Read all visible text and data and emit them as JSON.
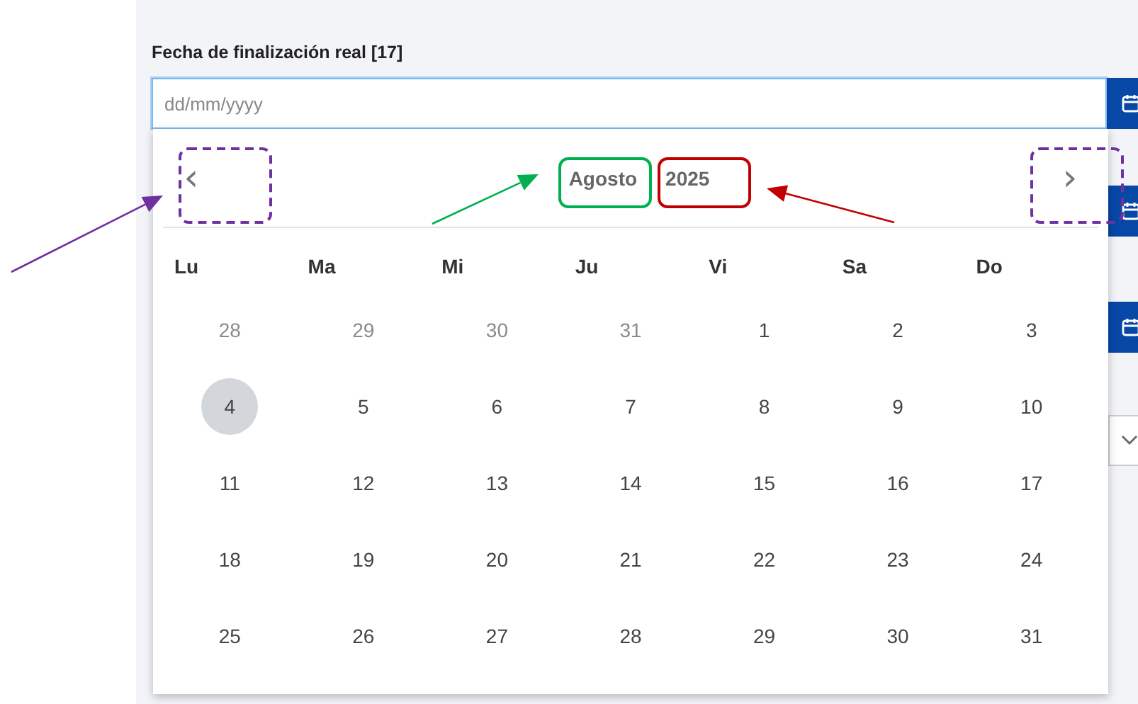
{
  "field": {
    "label": "Fecha de finalización real [17]",
    "placeholder": "dd/mm/yyyy"
  },
  "calendar": {
    "prev": "‹",
    "next": "›",
    "month": "Agosto",
    "year": "2025",
    "weekdays": [
      "Lu",
      "Ma",
      "Mi",
      "Ju",
      "Vi",
      "Sa",
      "Do"
    ],
    "weeks": [
      [
        {
          "day": "28",
          "outside": true,
          "selected": false
        },
        {
          "day": "29",
          "outside": true,
          "selected": false
        },
        {
          "day": "30",
          "outside": true,
          "selected": false
        },
        {
          "day": "31",
          "outside": true,
          "selected": false
        },
        {
          "day": "1",
          "outside": false,
          "selected": false
        },
        {
          "day": "2",
          "outside": false,
          "selected": false
        },
        {
          "day": "3",
          "outside": false,
          "selected": false
        }
      ],
      [
        {
          "day": "4",
          "outside": false,
          "selected": true
        },
        {
          "day": "5",
          "outside": false,
          "selected": false
        },
        {
          "day": "6",
          "outside": false,
          "selected": false
        },
        {
          "day": "7",
          "outside": false,
          "selected": false
        },
        {
          "day": "8",
          "outside": false,
          "selected": false
        },
        {
          "day": "9",
          "outside": false,
          "selected": false
        },
        {
          "day": "10",
          "outside": false,
          "selected": false
        }
      ],
      [
        {
          "day": "11",
          "outside": false,
          "selected": false
        },
        {
          "day": "12",
          "outside": false,
          "selected": false
        },
        {
          "day": "13",
          "outside": false,
          "selected": false
        },
        {
          "day": "14",
          "outside": false,
          "selected": false
        },
        {
          "day": "15",
          "outside": false,
          "selected": false
        },
        {
          "day": "16",
          "outside": false,
          "selected": false
        },
        {
          "day": "17",
          "outside": false,
          "selected": false
        }
      ],
      [
        {
          "day": "18",
          "outside": false,
          "selected": false
        },
        {
          "day": "19",
          "outside": false,
          "selected": false
        },
        {
          "day": "20",
          "outside": false,
          "selected": false
        },
        {
          "day": "21",
          "outside": false,
          "selected": false
        },
        {
          "day": "22",
          "outside": false,
          "selected": false
        },
        {
          "day": "23",
          "outside": false,
          "selected": false
        },
        {
          "day": "24",
          "outside": false,
          "selected": false
        }
      ],
      [
        {
          "day": "25",
          "outside": false,
          "selected": false
        },
        {
          "day": "26",
          "outside": false,
          "selected": false
        },
        {
          "day": "27",
          "outside": false,
          "selected": false
        },
        {
          "day": "28",
          "outside": false,
          "selected": false
        },
        {
          "day": "29",
          "outside": false,
          "selected": false
        },
        {
          "day": "30",
          "outside": false,
          "selected": false
        },
        {
          "day": "31",
          "outside": false,
          "selected": false
        }
      ]
    ]
  },
  "background_rows": [
    {
      "kind": "date"
    },
    {
      "kind": "date"
    },
    {
      "kind": "select"
    }
  ],
  "annotations": [
    {
      "kind": "arrow",
      "color": "#7030a0"
    },
    {
      "kind": "box",
      "color": "#7030a0"
    },
    {
      "kind": "arrow",
      "color": "#00b050"
    },
    {
      "kind": "box",
      "color": "#00b050"
    },
    {
      "kind": "box",
      "color": "#c00000"
    },
    {
      "kind": "arrow",
      "color": "#c00000"
    },
    {
      "kind": "box",
      "color": "#7030a0"
    }
  ]
}
